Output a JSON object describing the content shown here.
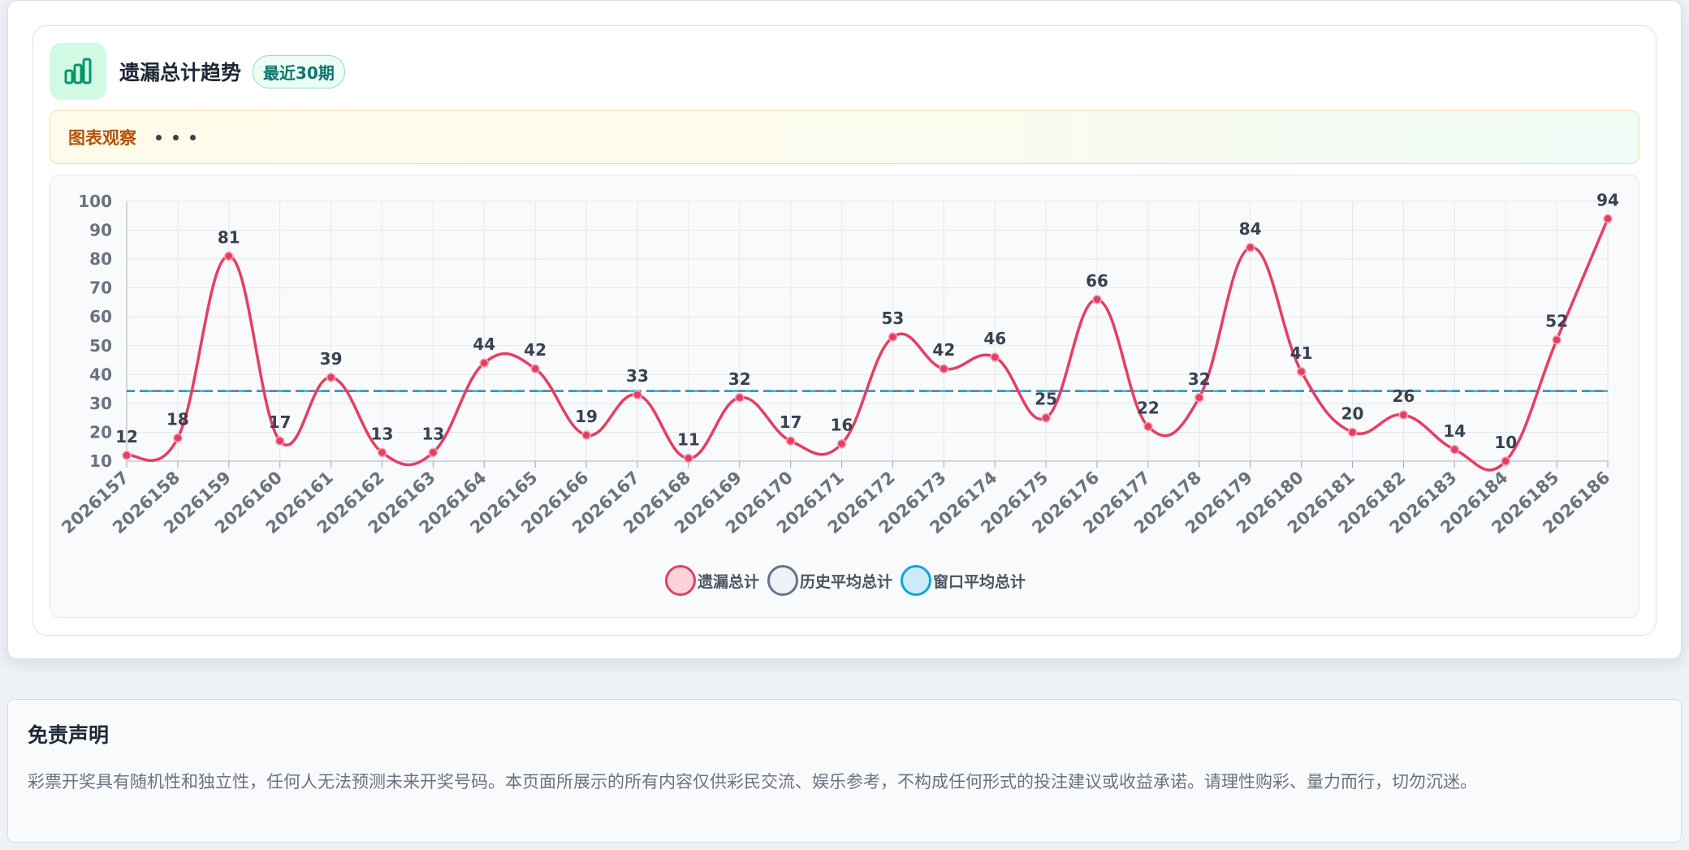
{
  "header": {
    "title": "遗漏总计趋势",
    "badge": "最近30期"
  },
  "observe": {
    "label": "图表观察"
  },
  "icons": {
    "header": "bar-chart-icon"
  },
  "colors": {
    "series_main": "#e63e62",
    "history_avg": "#64748b",
    "window_avg": "#0ea5d9",
    "accent": "#10b981"
  },
  "chart_data": {
    "type": "line",
    "categories": [
      "2026157",
      "2026158",
      "2026159",
      "2026160",
      "2026161",
      "2026162",
      "2026163",
      "2026164",
      "2026165",
      "2026166",
      "2026167",
      "2026168",
      "2026169",
      "2026170",
      "2026171",
      "2026172",
      "2026173",
      "2026174",
      "2026175",
      "2026176",
      "2026177",
      "2026178",
      "2026179",
      "2026180",
      "2026181",
      "2026182",
      "2026183",
      "2026184",
      "2026185",
      "2026186"
    ],
    "series": [
      {
        "name": "遗漏总计",
        "values": [
          12,
          18,
          81,
          17,
          39,
          13,
          13,
          44,
          42,
          19,
          33,
          11,
          32,
          17,
          16,
          53,
          42,
          46,
          25,
          66,
          22,
          32,
          84,
          41,
          20,
          26,
          14,
          10,
          52,
          94
        ]
      },
      {
        "name": "历史平均总计",
        "values": [
          34.3,
          34.3,
          34.3,
          34.3,
          34.3,
          34.3,
          34.3,
          34.3,
          34.3,
          34.3,
          34.3,
          34.3,
          34.3,
          34.3,
          34.3,
          34.3,
          34.3,
          34.3,
          34.3,
          34.3,
          34.3,
          34.3,
          34.3,
          34.3,
          34.3,
          34.3,
          34.3,
          34.3,
          34.3,
          34.3
        ]
      },
      {
        "name": "窗口平均总计",
        "values": [
          34.3,
          34.3,
          34.3,
          34.3,
          34.3,
          34.3,
          34.3,
          34.3,
          34.3,
          34.3,
          34.3,
          34.3,
          34.3,
          34.3,
          34.3,
          34.3,
          34.3,
          34.3,
          34.3,
          34.3,
          34.3,
          34.3,
          34.3,
          34.3,
          34.3,
          34.3,
          34.3,
          34.3,
          34.3,
          34.3
        ]
      }
    ],
    "ylim": [
      10,
      100
    ],
    "yticks": [
      10,
      20,
      30,
      40,
      50,
      60,
      70,
      80,
      90,
      100
    ],
    "grid": true,
    "legend": "bottom-center"
  },
  "disclaimer": {
    "title": "免责声明",
    "text": "彩票开奖具有随机性和独立性，任何人无法预测未来开奖号码。本页面所展示的所有内容仅供彩民交流、娱乐参考，不构成任何形式的投注建议或收益承诺。请理性购彩、量力而行，切勿沉迷。"
  }
}
